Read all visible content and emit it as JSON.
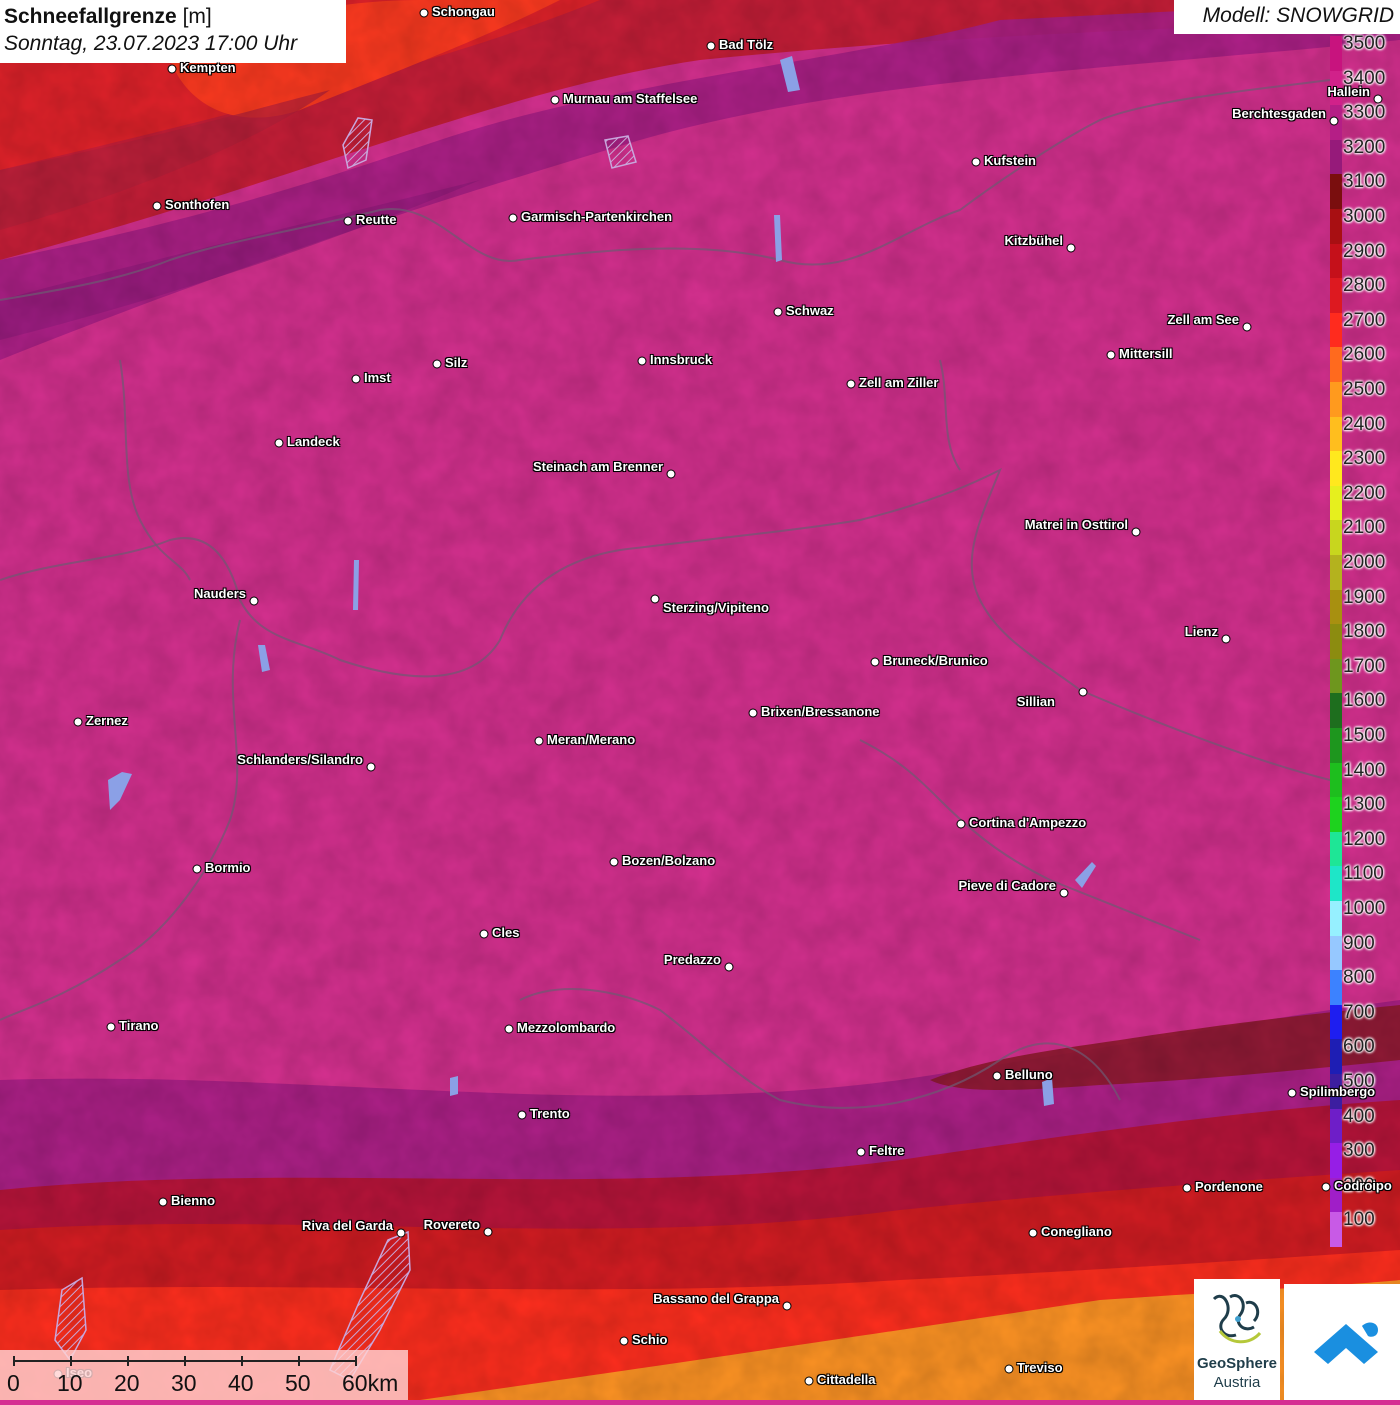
{
  "header": {
    "title_bold": "Schneefallgrenze",
    "title_unit": "[m]",
    "datetime": "Sonntag, 23.07.2023 17:00 Uhr",
    "model": "Modell: SNOWGRID"
  },
  "legend": {
    "labels": [
      "3500",
      "3400",
      "3300",
      "3200",
      "3100",
      "3000",
      "2900",
      "2800",
      "2700",
      "2600",
      "2500",
      "2400",
      "2300",
      "2200",
      "2100",
      "2000",
      "1900",
      "1800",
      "1700",
      "1600",
      "1500",
      "1400",
      "1300",
      "1200",
      "1100",
      "1000",
      "900",
      "800",
      "700",
      "600",
      "500",
      "400",
      "300",
      "200",
      "100"
    ],
    "colors": [
      "#c8137e",
      "#d1218a",
      "#b51e86",
      "#961a7a",
      "#7a0e0e",
      "#a80f12",
      "#c5101a",
      "#dd1920",
      "#ff2b1e",
      "#ff6a1e",
      "#ff9a1e",
      "#ffbe1e",
      "#ffe81e",
      "#e6ef1e",
      "#c8d61e",
      "#b4b21e",
      "#a89010",
      "#8c8c10",
      "#6e961e",
      "#1e6e1e",
      "#1e961e",
      "#1ebe1e",
      "#1ed21e",
      "#1ee696",
      "#1ee6c8",
      "#96f0ff",
      "#96c8ff",
      "#3c82ff",
      "#1e1ef0",
      "#1e1eb4",
      "#3c1ea0",
      "#6e1ec8",
      "#961ee6",
      "#a01ec8",
      "#c85ae6"
    ]
  },
  "scale": {
    "labels": [
      "0",
      "10",
      "20",
      "30",
      "40",
      "50",
      "60km"
    ]
  },
  "cities": [
    {
      "name": "Schongau"
    },
    {
      "name": "Bad Tölz"
    },
    {
      "name": "Kempten"
    },
    {
      "name": "Murnau am Staffelsee"
    },
    {
      "name": "Hallein"
    },
    {
      "name": "Berchtesgaden"
    },
    {
      "name": "Kufstein"
    },
    {
      "name": "Sonthofen"
    },
    {
      "name": "Reutte"
    },
    {
      "name": "Garmisch-Partenkirchen"
    },
    {
      "name": "Kitzbühel"
    },
    {
      "name": "Schwaz"
    },
    {
      "name": "Zell am See"
    },
    {
      "name": "Innsbruck"
    },
    {
      "name": "Mittersill"
    },
    {
      "name": "Silz"
    },
    {
      "name": "Imst"
    },
    {
      "name": "Zell am Ziller"
    },
    {
      "name": "Landeck"
    },
    {
      "name": "Steinach am Brenner"
    },
    {
      "name": "Matrei in Osttirol"
    },
    {
      "name": "Nauders"
    },
    {
      "name": "Sterzing/Vipiteno"
    },
    {
      "name": "Lienz"
    },
    {
      "name": "Bruneck/Brunico"
    },
    {
      "name": "Sillian"
    },
    {
      "name": "Brixen/Bressanone"
    },
    {
      "name": "Zernez"
    },
    {
      "name": "Meran/Merano"
    },
    {
      "name": "Schlanders/Silandro"
    },
    {
      "name": "Cortina d'Ampezzo"
    },
    {
      "name": "Bozen/Bolzano"
    },
    {
      "name": "Pieve di Cadore"
    },
    {
      "name": "Bormio"
    },
    {
      "name": "Cles"
    },
    {
      "name": "Predazzo"
    },
    {
      "name": "Tirano"
    },
    {
      "name": "Mezzolombardo"
    },
    {
      "name": "Belluno"
    },
    {
      "name": "Spilimbergo"
    },
    {
      "name": "Trento"
    },
    {
      "name": "Feltre"
    },
    {
      "name": "Pordenone"
    },
    {
      "name": "Codroipo"
    },
    {
      "name": "Bienno"
    },
    {
      "name": "Riva del Garda"
    },
    {
      "name": "Rovereto"
    },
    {
      "name": "Conegliano"
    },
    {
      "name": "Bassano del Grappa"
    },
    {
      "name": "Schio"
    },
    {
      "name": "Treviso"
    },
    {
      "name": "Cittadella"
    },
    {
      "name": "Iseo"
    }
  ],
  "logo": {
    "line1": "GeoSphere",
    "line2": "Austria"
  }
}
